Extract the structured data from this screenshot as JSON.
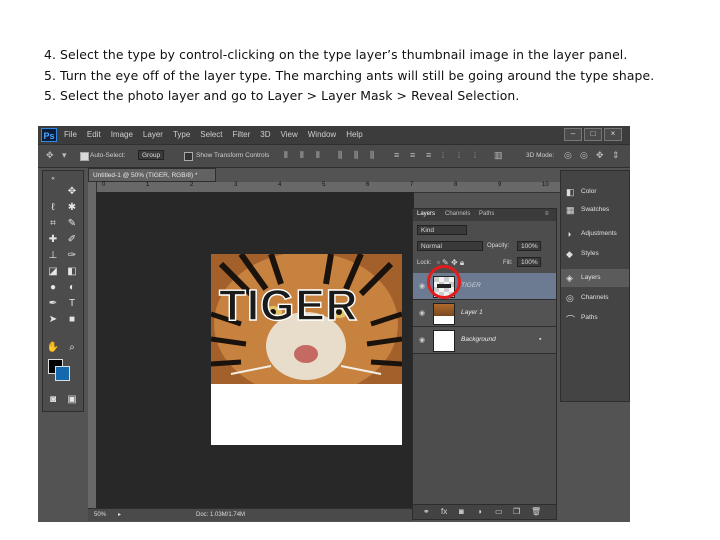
{
  "instructions": [
    "4. Select the type by control-clicking on the type layer’s thumbnail image in the layer panel.",
    "5. Turn the eye off of the layer type. The marching ants will still be going around the type shape.",
    "5. Select the photo layer and go to Layer > Layer Mask > Reveal Selection."
  ],
  "app": {
    "logo": "Ps",
    "menu": [
      "File",
      "Edit",
      "Image",
      "Layer",
      "Type",
      "Select",
      "Filter",
      "3D",
      "View",
      "Window",
      "Help"
    ],
    "window_buttons": [
      "–",
      "□",
      "×"
    ]
  },
  "options_bar": {
    "auto_select_label": "Auto-Select:",
    "auto_select_value": "Group",
    "transform_label": "Show Transform Controls",
    "mode_label": "3D Mode:"
  },
  "tools": {
    "items": [
      "move-icon",
      "marquee-icon",
      "lasso-icon",
      "crop-icon",
      "eyedropper-icon",
      "healing-icon",
      "brush-icon",
      "stamp-icon",
      "history-brush-icon",
      "eraser-icon",
      "gradient-icon",
      "dodge-icon",
      "pen-icon",
      "type-icon",
      "path-select-icon",
      "shape-icon",
      "hand-icon",
      "zoom-icon"
    ],
    "foreground_color": "#000000",
    "background_color": "#1468ad"
  },
  "document": {
    "tab_title": "Untitled-1 @ 50% (TIGER, RGB/8) *",
    "ruler_ticks": [
      "0",
      "1",
      "2",
      "3",
      "4",
      "5",
      "6",
      "7",
      "8",
      "9",
      "10",
      "11",
      "12"
    ],
    "type_text": "TIGER",
    "status_zoom": "50%",
    "status_doc": "Doc: 1.03M/1.74M"
  },
  "layers_panel": {
    "tabs": [
      "Layers",
      "Channels",
      "Paths"
    ],
    "kind": "Kind",
    "blend_mode": "Normal",
    "opacity_label": "Opacity:",
    "opacity_value": "100%",
    "lock_label": "Lock:",
    "fill_label": "Fill:",
    "fill_value": "100%",
    "layers": [
      {
        "name": "TIGER",
        "type": "text"
      },
      {
        "name": "Layer 1",
        "type": "photo"
      },
      {
        "name": "Background",
        "type": "background"
      }
    ],
    "highlight_color": "#e31b1b"
  },
  "dock": {
    "items": [
      {
        "label": "Color",
        "icon": "color-icon"
      },
      {
        "label": "Swatches",
        "icon": "swatches-icon"
      },
      {
        "label": "Adjustments",
        "icon": "adjustments-icon"
      },
      {
        "label": "Styles",
        "icon": "styles-icon"
      },
      {
        "label": "Layers",
        "icon": "layers-icon"
      },
      {
        "label": "Channels",
        "icon": "channels-icon"
      },
      {
        "label": "Paths",
        "icon": "paths-icon"
      }
    ]
  }
}
